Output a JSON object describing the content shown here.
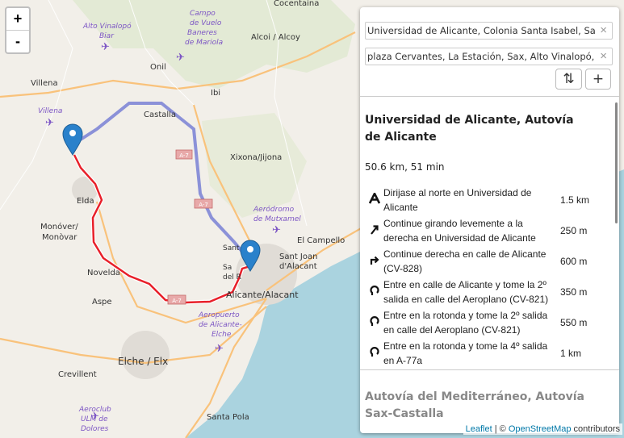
{
  "zoom": {
    "in_label": "+",
    "out_label": "-"
  },
  "map": {
    "places": [
      {
        "name": "Cocentaina"
      },
      {
        "name": "Campo de Vuelo Baneres de Mariola"
      },
      {
        "name": "Alto Vinalopó Biar"
      },
      {
        "name": "Alcoi / Alcoy"
      },
      {
        "name": "Onil"
      },
      {
        "name": "Ibi"
      },
      {
        "name": "Villena"
      },
      {
        "name": "Castalla"
      },
      {
        "name": "Xixona/Jijona"
      },
      {
        "name": "Elda"
      },
      {
        "name": "Aeródromo de Mutxamel"
      },
      {
        "name": "Monóver/Monòvar"
      },
      {
        "name": "El Campello"
      },
      {
        "name": "Sant Joan d'Alacant"
      },
      {
        "name": "Novelda"
      },
      {
        "name": "Alicante/Alacant"
      },
      {
        "name": "Aspe"
      },
      {
        "name": "Aeropuerto de Alicante-Elche"
      },
      {
        "name": "Elche / Elx"
      },
      {
        "name": "Crevillent"
      },
      {
        "name": "Aeroclub ULM de Dolores"
      },
      {
        "name": "Santa Pola"
      },
      {
        "name": "San Vicente del Raspeig"
      }
    ],
    "road_shields": [
      "A-7",
      "A-7",
      "A-7"
    ]
  },
  "routing": {
    "from_value": "Universidad de Alicante, Colonia Santa Isabel, San Vicente del Raspeig",
    "to_value": "plaza Cervantes, La Estación, Sax, Alto Vinalopó, Alicante",
    "clear_icon": "×",
    "reverse_icon": "⇅",
    "add_icon": "+",
    "route_title": "Universidad de Alicante, Autovía de Alicante",
    "summary": "50.6 km, 51 min",
    "instructions": [
      {
        "icon": "depart-icon",
        "text": "Dirijase al norte en Universidad de Alicante",
        "distance": "1.5 km"
      },
      {
        "icon": "slight-right-icon",
        "text": "Continue girando levemente a la derecha en Universidad de Alicante",
        "distance": "250 m"
      },
      {
        "icon": "turn-right-icon",
        "text": "Continue derecha en calle de Alicante (CV-828)",
        "distance": "600 m"
      },
      {
        "icon": "roundabout-icon",
        "text": "Entre en calle de Alicante y tome la 2º salida en calle del Aeroplano (CV-821)",
        "distance": "350 m"
      },
      {
        "icon": "roundabout-icon",
        "text": "Entre en la rotonda y tome la 2º salida en calle del Aeroplano (CV-821)",
        "distance": "550 m"
      },
      {
        "icon": "roundabout-icon",
        "text": "Entre en la rotonda y tome la 4º salida en A-77a",
        "distance": "1 km"
      }
    ],
    "alt_route_title": "Autovía del Mediterráneo, Autovía Sax-Castalla"
  },
  "attribution": {
    "leaflet": "Leaflet",
    "sep": " | © ",
    "osm": "OpenStreetMap",
    "suffix": " contributors"
  },
  "colors": {
    "main_route": "#e8202a",
    "alt_route": "#7f86d6",
    "marker": "#2a81cb",
    "sea": "#aad3df",
    "land": "#f2efe9"
  }
}
